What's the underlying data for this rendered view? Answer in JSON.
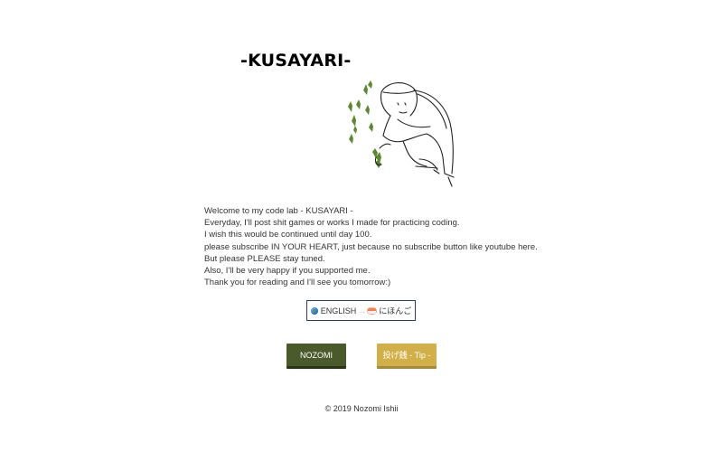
{
  "header": {
    "title": "-KUSAYARI-"
  },
  "intro": {
    "lines": [
      "Welcome to my code lab - KUSAYARI -",
      "Everyday, I'll post shit games or works I made for practicing coding.",
      "I wish this would be continued until day 100.",
      "please subscribe IN YOUR HEART, just because no subscribe button like youtube here.",
      "But please PLEASE stay tuned.",
      "Also, I'll be very happy if you supported me.",
      "Thank you for reading and I'll see you tomorrow:)"
    ]
  },
  "language_switch": {
    "from_label": "ENGLISH",
    "arrow": "→",
    "to_label": "にほんご",
    "from_icon": "globe-icon",
    "to_icon": "sushi-icon"
  },
  "buttons": {
    "nozomi_label": "NOZOMI",
    "tip_label": "投げ銭 - Tip -"
  },
  "footer": {
    "copyright": "© 2019 Nozomi Ishii"
  },
  "colors": {
    "nozomi_button": "#4a5a2b",
    "tip_button": "#d1b04a",
    "grass_green": "#5b8a2e",
    "language_border": "#2c3a6e"
  },
  "illustration": {
    "icon": "person-pulling-grass-illustration"
  }
}
